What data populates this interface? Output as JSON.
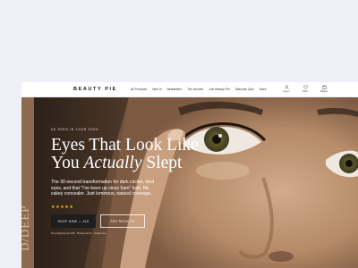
{
  "nav": {
    "logo": "BEAUTY PIE",
    "links": [
      "All Products",
      "New In",
      "Bestsellers",
      "The Archive",
      "Join Beauty Pie",
      "Skincare Quiz",
      "More"
    ],
    "icons": [
      {
        "name": "account-icon",
        "label": "Log in"
      },
      {
        "name": "heart-icon",
        "label": "Wish"
      },
      {
        "name": "bag-icon",
        "label": "Basket"
      }
    ]
  },
  "hero": {
    "eyebrow": "AS SEEN IN YOUR FEED",
    "headline_line1": "Eyes That Look Like",
    "headline_line2_pre": "You ",
    "headline_line2_em": "Actually",
    "headline_line2_post": " Slept",
    "subtext": "The 30-second transformation for dark circles, tired eyes, and that \"I've been up since 5am\" look. No cakey concealer. Just luminous, natural coverage.",
    "stars": "★★★★★",
    "primary_button": "SHOP NOW — £18",
    "secondary_button": "SEE RESULTS",
    "footnote": "Free shipping over £30 · 60-day returns · Cruelty free",
    "vertical_text": "D/DEEP"
  },
  "colors": {
    "accent": "#1e1e1e",
    "star": "#f2c200",
    "page_bg": "#eef0f6"
  }
}
